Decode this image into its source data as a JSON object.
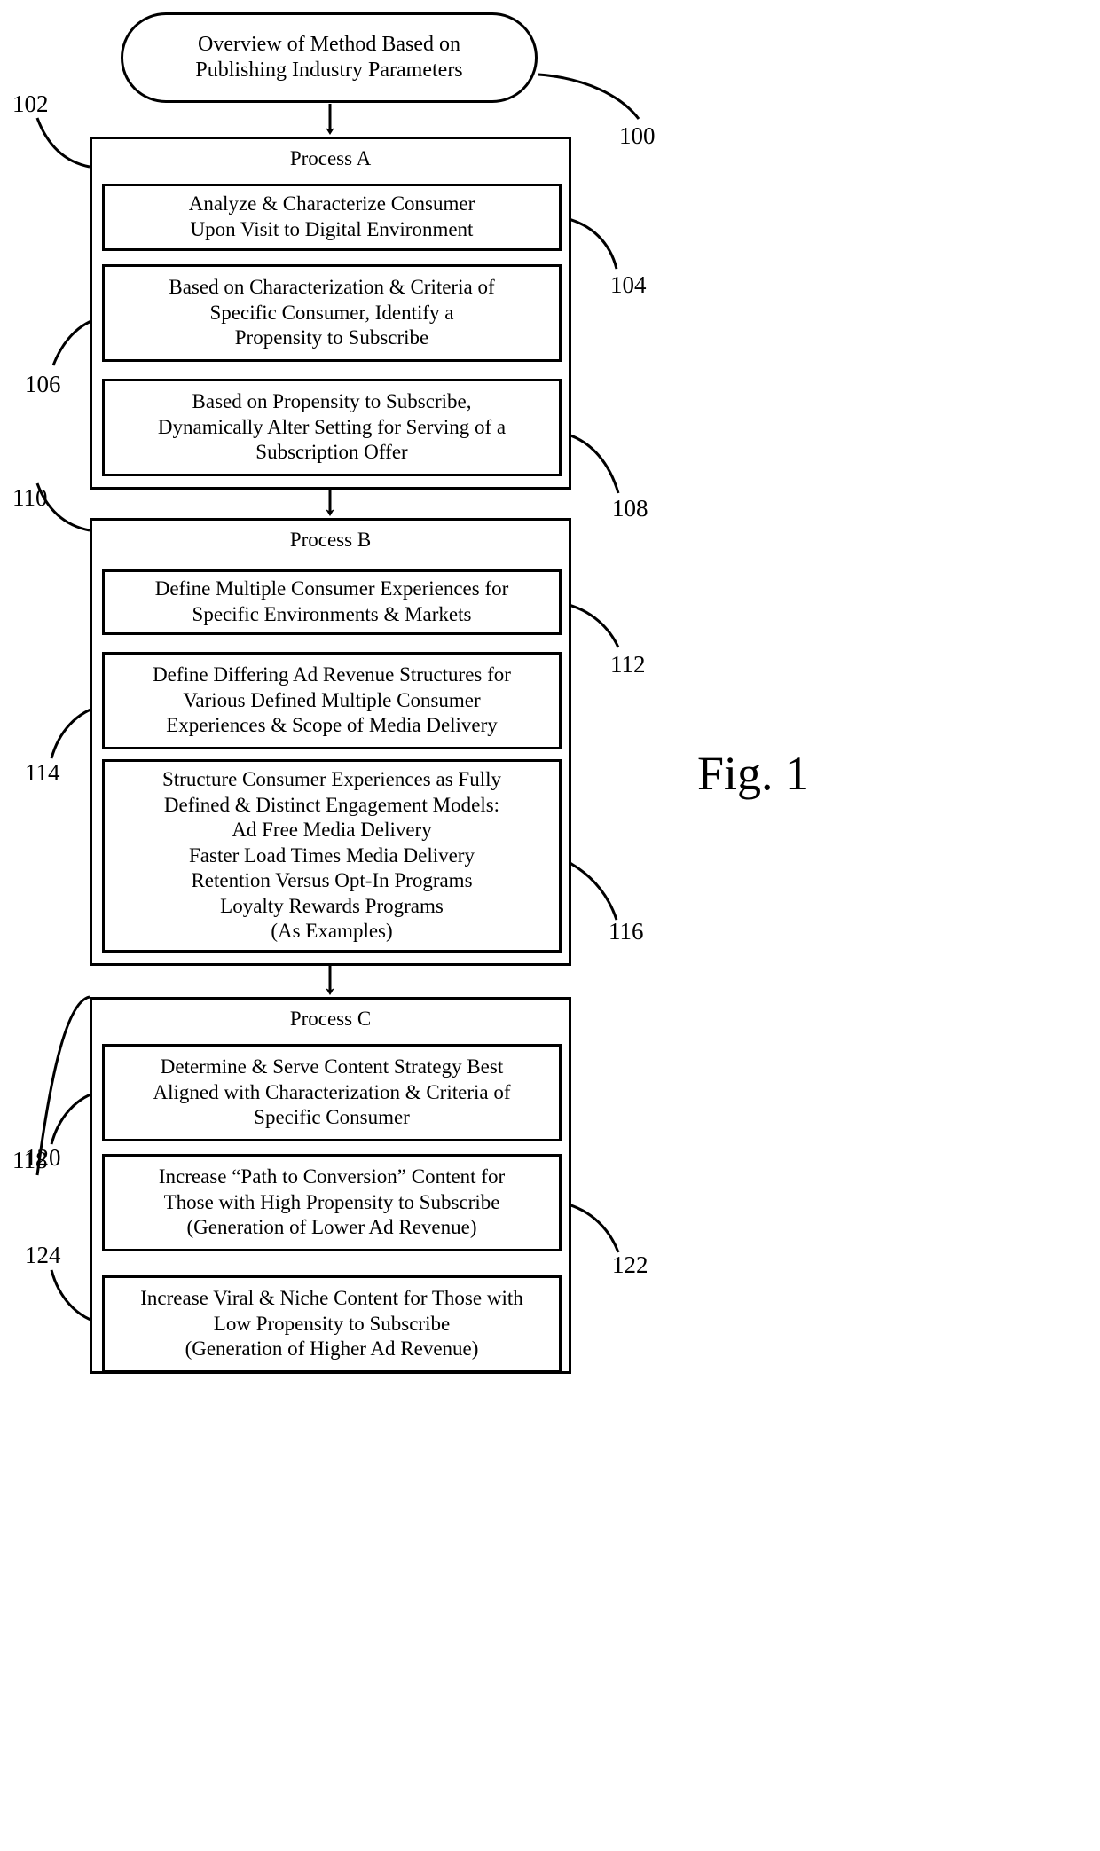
{
  "figure": {
    "label": "Fig. 1",
    "title": {
      "line1": "Overview of Method Based on",
      "line2": "Publishing Industry Parameters",
      "ref": "100"
    }
  },
  "processes": [
    {
      "id": "process-a",
      "heading": "Process A",
      "ref": "102",
      "steps": [
        {
          "ref": "104",
          "lines": [
            "Analyze & Characterize Consumer",
            "Upon Visit to Digital Environment"
          ]
        },
        {
          "ref": "106",
          "lines": [
            "Based on Characterization & Criteria of",
            "Specific Consumer, Identify a",
            "Propensity to Subscribe"
          ]
        },
        {
          "ref": "108",
          "lines": [
            "Based on Propensity to Subscribe,",
            "Dynamically Alter Setting for Serving of a",
            "Subscription Offer"
          ]
        }
      ]
    },
    {
      "id": "process-b",
      "heading": "Process B",
      "ref": "110",
      "steps": [
        {
          "ref": "112",
          "lines": [
            "Define Multiple Consumer Experiences for",
            "Specific Environments & Markets"
          ]
        },
        {
          "ref": "114",
          "lines": [
            "Define Differing Ad Revenue Structures for",
            "Various Defined Multiple Consumer",
            "Experiences & Scope of Media Delivery"
          ]
        },
        {
          "ref": "116",
          "lines": [
            "Structure Consumer Experiences as Fully",
            "Defined & Distinct Engagement Models:",
            "Ad Free Media Delivery",
            "Faster Load Times Media Delivery",
            "Retention Versus Opt-In Programs",
            "Loyalty Rewards Programs",
            "(As Examples)"
          ]
        }
      ]
    },
    {
      "id": "process-c",
      "heading": "Process C",
      "ref": "118",
      "steps": [
        {
          "ref": "120",
          "lines": [
            "Determine & Serve Content Strategy Best",
            "Aligned with Characterization & Criteria of",
            "Specific Consumer"
          ]
        },
        {
          "ref": "122",
          "lines": [
            "Increase “Path to Conversion” Content for",
            "Those with High Propensity to Subscribe",
            "(Generation of Lower Ad Revenue)"
          ]
        },
        {
          "ref": "124",
          "lines": [
            "Increase Viral & Niche Content for Those with",
            "Low Propensity to Subscribe",
            "(Generation of Higher Ad Revenue)"
          ]
        }
      ]
    }
  ],
  "connectors": [
    {
      "name": "title-to-process-a"
    },
    {
      "name": "process-a-to-process-b"
    },
    {
      "name": "process-b-to-process-c"
    }
  ],
  "colors": {
    "stroke": "#000000",
    "background": "#ffffff"
  }
}
